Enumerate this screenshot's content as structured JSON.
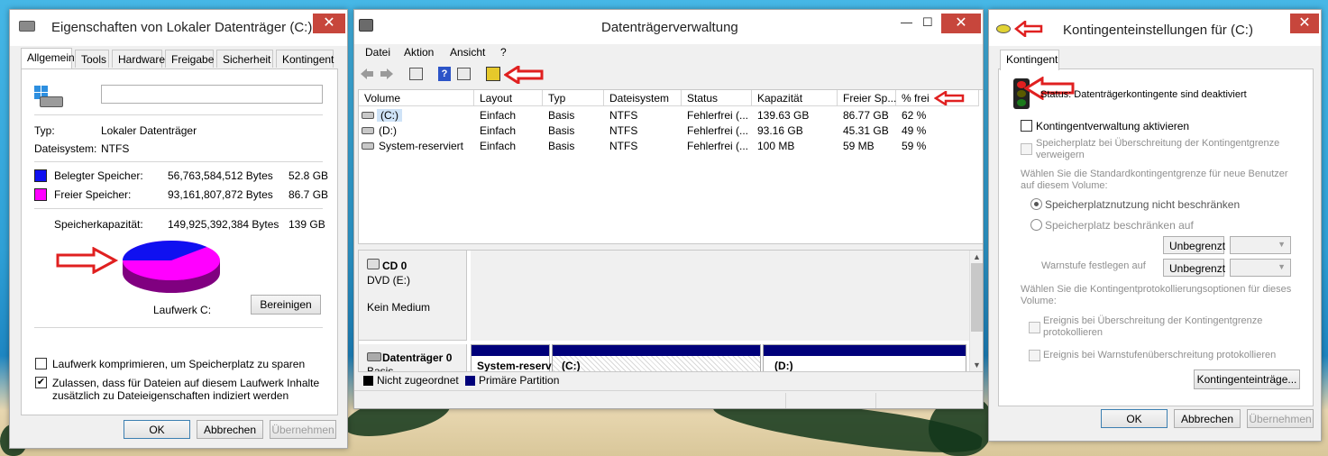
{
  "left_window": {
    "title": "Eigenschaften von Lokaler Datenträger (C:)",
    "close": "✕",
    "tabs": [
      "Allgemein",
      "Tools",
      "Hardware",
      "Freigabe",
      "Sicherheit",
      "Kontingent"
    ],
    "label_value": "",
    "type_label": "Typ:",
    "type_value": "Lokaler Datenträger",
    "fs_label": "Dateisystem:",
    "fs_value": "NTFS",
    "used_label": "Belegter Speicher:",
    "used_bytes": "56,763,584,512 Bytes",
    "used_gb": "52.8 GB",
    "free_label": "Freier Speicher:",
    "free_bytes": "93,161,807,872 Bytes",
    "free_gb": "86.7 GB",
    "cap_label": "Speicherkapazität:",
    "cap_bytes": "149,925,392,384 Bytes",
    "cap_gb": "139 GB",
    "used_fraction": 0.38,
    "drive_label": "Laufwerk C:",
    "cleanup_button": "Bereinigen",
    "compress_label": "Laufwerk komprimieren, um Speicherplatz zu sparen",
    "compress_checked": false,
    "index_label_1": "Zulassen, dass für Dateien auf diesem Laufwerk Inhalte",
    "index_label_2": "zusätzlich zu Dateieigenschaften indiziert werden",
    "index_checked": true,
    "ok": "OK",
    "cancel": "Abbrechen",
    "apply": "Übernehmen",
    "colors": {
      "used": "#1010f0",
      "free": "#ff00ff"
    }
  },
  "middle_window": {
    "title": "Datenträgerverwaltung",
    "minimize": "—",
    "maximize": "☐",
    "close": "✕",
    "menu": [
      "Datei",
      "Aktion",
      "Ansicht",
      "?"
    ],
    "columns": [
      "Volume",
      "Layout",
      "Typ",
      "Dateisystem",
      "Status",
      "Kapazität",
      "Freier Sp...",
      "% frei"
    ],
    "rows": [
      [
        "(C:)",
        "Einfach",
        "Basis",
        "NTFS",
        "Fehlerfrei (...",
        "139.63 GB",
        "86.77 GB",
        "62 %"
      ],
      [
        "(D:)",
        "Einfach",
        "Basis",
        "NTFS",
        "Fehlerfrei (...",
        "93.16 GB",
        "45.31 GB",
        "49 %"
      ],
      [
        "System-reserviert",
        "Einfach",
        "Basis",
        "NTFS",
        "Fehlerfrei (...",
        "100 MB",
        "59 MB",
        "59 %"
      ]
    ],
    "cd_name": "CD 0",
    "cd_drive": "DVD (E:)",
    "cd_media": "Kein Medium",
    "disk_name": "Datenträger 0",
    "disk_type": "Basis",
    "partitions": [
      "System-reserv",
      "(C:)",
      "(D:)"
    ],
    "legend": [
      "Nicht zugeordnet",
      "Primäre Partition"
    ]
  },
  "right_window": {
    "title": "Kontingenteinstellungen für  (C:)",
    "close": "✕",
    "tab": "Kontingent",
    "status": "Status:  Datenträgerkontingente sind deaktiviert",
    "enable_label": "Kontingentverwaltung aktivieren",
    "deny_label_1": "Speicherplatz bei Überschreitung der Kontingentgrenze",
    "deny_label_2": "verweigern",
    "default_label_1": "Wählen Sie die Standardkontingentgrenze für neue Benutzer",
    "default_label_2": "auf diesem Volume:",
    "no_limit": "Speicherplatznutzung nicht beschränken",
    "limit": "Speicherplatz beschränken auf",
    "limit_value": "Unbegrenzt",
    "warn_label": "Warnstufe festlegen auf",
    "warn_value": "Unbegrenzt",
    "log_label_1": "Wählen Sie die Kontingentprotokollierungsoptionen für dieses",
    "log_label_2": "Volume:",
    "log_exceed_1": "Ereignis bei Überschreitung der Kontingentgrenze",
    "log_exceed_2": "protokollieren",
    "log_warn": "Ereignis bei Warnstufenüberschreitung protokollieren",
    "entries_button": "Kontingenteinträge...",
    "ok": "OK",
    "cancel": "Abbrechen",
    "apply": "Übernehmen"
  }
}
